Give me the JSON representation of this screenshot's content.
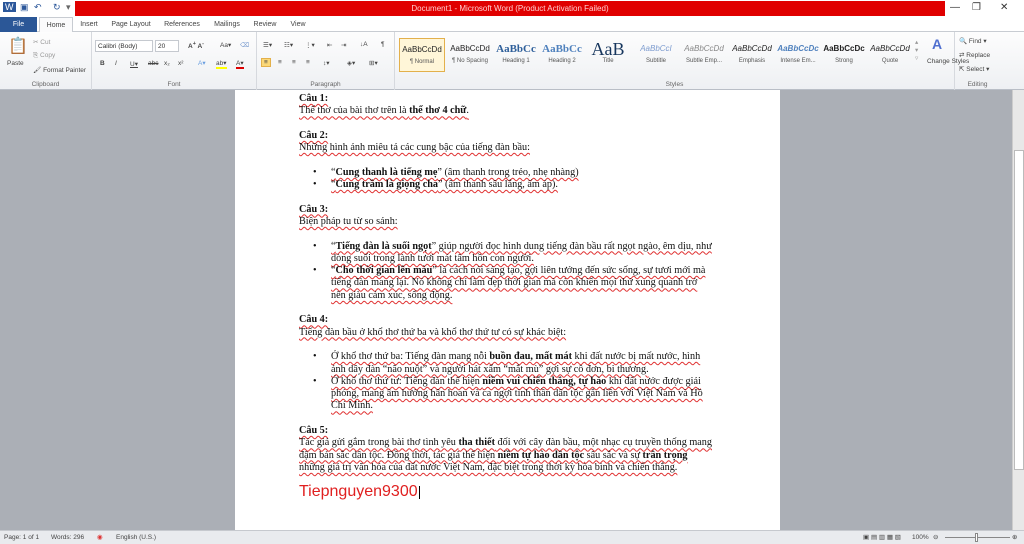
{
  "title_bar": {
    "title": "Document1 - Microsoft Word (Product Activation Failed)",
    "accent": "#e00000"
  },
  "tabs": [
    "File",
    "Home",
    "Insert",
    "Page Layout",
    "References",
    "Mailings",
    "Review",
    "View"
  ],
  "clipboard": {
    "paste": "Paste",
    "cut": "Cut",
    "copy": "Copy",
    "format_painter": "Format Painter",
    "label": "Clipboard"
  },
  "font": {
    "name": "Calibri (Body)",
    "size": "20",
    "label": "Font"
  },
  "paragraph": {
    "label": "Paragraph"
  },
  "styles": {
    "label": "Styles",
    "items": [
      {
        "sample": "AaBbCcDd",
        "name": "¶ Normal"
      },
      {
        "sample": "AaBbCcDd",
        "name": "¶ No Spacing"
      },
      {
        "sample": "AaBbCc",
        "name": "Heading 1"
      },
      {
        "sample": "AaBbCc",
        "name": "Heading 2"
      },
      {
        "sample": "AaB",
        "name": "Title"
      },
      {
        "sample": "AaBbCcI",
        "name": "Subtitle"
      },
      {
        "sample": "AaBbCcDd",
        "name": "Subtle Emp..."
      },
      {
        "sample": "AaBbCcDd",
        "name": "Emphasis"
      },
      {
        "sample": "AaBbCcDc",
        "name": "Intense Em..."
      },
      {
        "sample": "AaBbCcDc",
        "name": "Strong"
      },
      {
        "sample": "AaBbCcDd",
        "name": "Quote"
      }
    ],
    "change_styles": "Change Styles"
  },
  "editing": {
    "find": "Find",
    "replace": "Replace",
    "select": "Select",
    "label": "Editing"
  },
  "document": {
    "blocks": [
      {
        "type": "h",
        "segs": [
          {
            "t": "Câu 1:",
            "b": 1
          }
        ]
      },
      {
        "type": "p",
        "segs": [
          {
            "t": "Thể thơ của bài thơ trên là "
          },
          {
            "t": "thể thơ 4 chữ",
            "b": 1
          },
          {
            "t": "."
          }
        ]
      },
      {
        "type": "gap"
      },
      {
        "type": "h",
        "segs": [
          {
            "t": "Câu 2:",
            "b": 1
          }
        ]
      },
      {
        "type": "p",
        "segs": [
          {
            "t": "Những hình ảnh miêu tả các cung bậc của tiếng đàn bầu:"
          }
        ]
      },
      {
        "type": "gap"
      },
      {
        "type": "li",
        "segs": [
          {
            "t": "“"
          },
          {
            "t": "Cung thanh là tiếng mẹ",
            "b": 1
          },
          {
            "t": "” (âm thanh trong trẻo, nhẹ nhàng)"
          }
        ]
      },
      {
        "type": "li",
        "segs": [
          {
            "t": "“"
          },
          {
            "t": "Cung trầm là giọng cha",
            "b": 1
          },
          {
            "t": "” (âm thanh sâu lắng, ấm áp)."
          }
        ]
      },
      {
        "type": "gap"
      },
      {
        "type": "h",
        "segs": [
          {
            "t": "Câu 3:",
            "b": 1
          }
        ]
      },
      {
        "type": "p",
        "segs": [
          {
            "t": "Biện pháp tu từ so sánh:"
          }
        ]
      },
      {
        "type": "gap"
      },
      {
        "type": "li",
        "segs": [
          {
            "t": "“"
          },
          {
            "t": "Tiếng đàn là suối ngọt",
            "b": 1
          },
          {
            "t": "” giúp người đọc hình dung tiếng đàn bầu rất ngọt ngào, êm dịu, như dòng suối trong lành tươi mát tâm hồn con người."
          }
        ]
      },
      {
        "type": "li",
        "segs": [
          {
            "t": "“"
          },
          {
            "t": "Cho thời gian lên màu",
            "b": 1
          },
          {
            "t": "” là cách nói sáng tạo, gợi liên tưởng đến sức sống, sự tươi mới mà tiếng đàn mang lại. Nó không chỉ làm đẹp thời gian mà còn khiến mọi thứ xung quanh trở nên giàu cảm xúc, sống động."
          }
        ]
      },
      {
        "type": "gap"
      },
      {
        "type": "h",
        "segs": [
          {
            "t": "Câu 4:",
            "b": 1
          }
        ]
      },
      {
        "type": "p",
        "segs": [
          {
            "t": "Tiếng đàn bầu ở khổ thơ thứ ba và khổ thơ thứ tư có sự khác biệt:"
          }
        ]
      },
      {
        "type": "gap"
      },
      {
        "type": "li",
        "segs": [
          {
            "t": "Ở khổ thơ thứ ba: Tiếng đàn mang nỗi "
          },
          {
            "t": "buồn đau, mất mát",
            "b": 1
          },
          {
            "t": " khi đất nước bị mất nước, hình ảnh dây đàn “não nuột” và người hát xẩm “mắt mù” gợi sự cô đơn, bi thương."
          }
        ]
      },
      {
        "type": "li",
        "segs": [
          {
            "t": "Ở khổ thơ thứ tư: Tiếng đàn thể hiện "
          },
          {
            "t": "niềm vui chiến thắng, tự hào",
            "b": 1
          },
          {
            "t": " khi đất nước được giải phóng, mang âm hưởng hân hoan và ca ngợi tinh thần dân tộc gắn liền với Việt Nam và Hồ Chí Minh."
          }
        ]
      },
      {
        "type": "gap"
      },
      {
        "type": "h",
        "segs": [
          {
            "t": "Câu 5:",
            "b": 1
          }
        ]
      },
      {
        "type": "p",
        "segs": [
          {
            "t": "Tác giả gửi gắm trong bài thơ tình yêu "
          },
          {
            "t": "tha thiết",
            "b": 1
          },
          {
            "t": " đối với cây đàn bầu, một nhạc cụ truyền thống mang đậm bản sắc dân tộc. Đồng thời, tác giả thể hiện "
          },
          {
            "t": "niềm tự hào dân tộc",
            "b": 1
          },
          {
            "t": " sâu sắc và sự "
          },
          {
            "t": "trân trọng",
            "b": 1
          },
          {
            "t": " những giá trị văn hóa của đất nước Việt Nam, đặc biệt trong thời kỳ hòa bình và chiến thắng."
          }
        ]
      }
    ],
    "signature": "Tiepnguyen9300",
    "signature_color": "#e02020"
  },
  "status": {
    "page": "Page: 1 of 1",
    "words": "Words: 296",
    "language": "English (U.S.)",
    "zoom": "100%"
  }
}
